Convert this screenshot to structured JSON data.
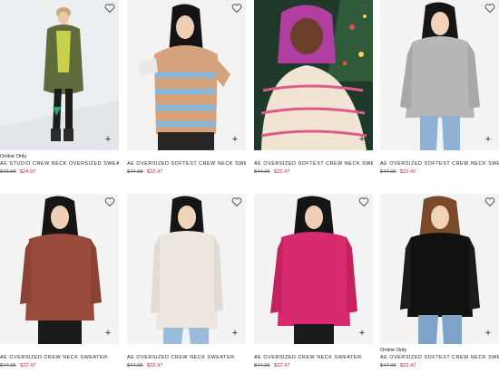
{
  "products": [
    {
      "badge": "Online Only",
      "title": "AE STUDIO CREW NECK OVERSIZED SWEATER",
      "original_price": "$49.95",
      "sale_price": "$24.97"
    },
    {
      "badge": "",
      "title": "AE OVERSIZED SOFTEST CREW NECK SWEATER",
      "original_price": "$44.95",
      "sale_price": "$22.47"
    },
    {
      "badge": "",
      "title": "AE OVERSIZED SOFTEST CREW NECK SWEATER",
      "original_price": "$44.95",
      "sale_price": "$22.47"
    },
    {
      "badge": "",
      "title": "AE OVERSIZED SOFTEST CREW NECK SWEATER",
      "original_price": "$44.95",
      "sale_price": "$22.47"
    },
    {
      "badge": "",
      "title": "AE OVERSIZED CREW NECK SWEATER",
      "original_price": "$44.95",
      "sale_price": "$22.47"
    },
    {
      "badge": "",
      "title": "AE OVERSIZED CREW NECK SWEATER",
      "original_price": "$44.95",
      "sale_price": "$22.47"
    },
    {
      "badge": "",
      "title": "AE OVERSIZED CREW NECK SWEATER",
      "original_price": "$44.95",
      "sale_price": "$22.47"
    },
    {
      "badge": "Online Only",
      "title": "AE OVERSIZED SOFTEST CREW NECK SWEATER",
      "original_price": "$44.95",
      "sale_price": "$22.47"
    }
  ],
  "icons": {
    "favorite": "heart-icon",
    "quick_add": "plus-icon"
  },
  "colors": {
    "sale": "#d7263d",
    "original": "#666666"
  }
}
